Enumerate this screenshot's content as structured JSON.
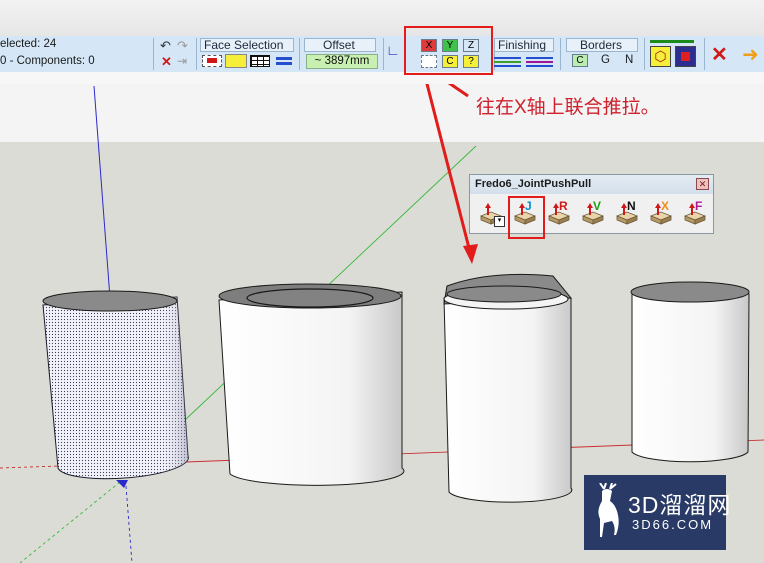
{
  "status": {
    "selected": "elected: 24",
    "components": "0 - Components: 0"
  },
  "toolbar": {
    "face_selection_label": "Face Selection",
    "offset_label": "Offset",
    "offset_value": "~ 3897mm",
    "axis_x": "X",
    "axis_y": "Y",
    "axis_z": "Z",
    "axis_c": "C",
    "axis_q": "?",
    "finishing_label": "Finishing",
    "borders_label": "Borders",
    "border_c": "C",
    "border_g": "G",
    "border_n": "N"
  },
  "annotation": "往在X轴上联合推拉。",
  "dialog": {
    "title": "Fredo6_JointPushPull",
    "close_glyph": "✕",
    "tools": [
      {
        "letter": "",
        "icon": "push-pull-menu-icon",
        "color": "#d01818"
      },
      {
        "letter": "J",
        "icon": "joint-push-pull-icon",
        "color": "#0a8fd0"
      },
      {
        "letter": "R",
        "icon": "round-push-pull-icon",
        "color": "#d01818"
      },
      {
        "letter": "V",
        "icon": "vector-push-pull-icon",
        "color": "#19a019"
      },
      {
        "letter": "N",
        "icon": "normal-push-pull-icon",
        "color": "#111111"
      },
      {
        "letter": "X",
        "icon": "extrude-push-pull-icon",
        "color": "#f08a18"
      },
      {
        "letter": "F",
        "icon": "follow-push-pull-icon",
        "color": "#b0189a"
      }
    ]
  },
  "watermark": {
    "brand": "3D溜溜网",
    "domain": "3D66.COM"
  },
  "colors": {
    "highlight_red": "#e21b1b",
    "offset_field_bg": "#c8f0b0",
    "axis_x_bg": "#e03a3a",
    "axis_y_bg": "#3fc24a",
    "axis_z_bg": "#d5e7f7",
    "axis_c_bg": "#f6ef3a",
    "axis_q_bg": "#f6ef3a",
    "toolbar_bg": "#d5e7f7"
  }
}
